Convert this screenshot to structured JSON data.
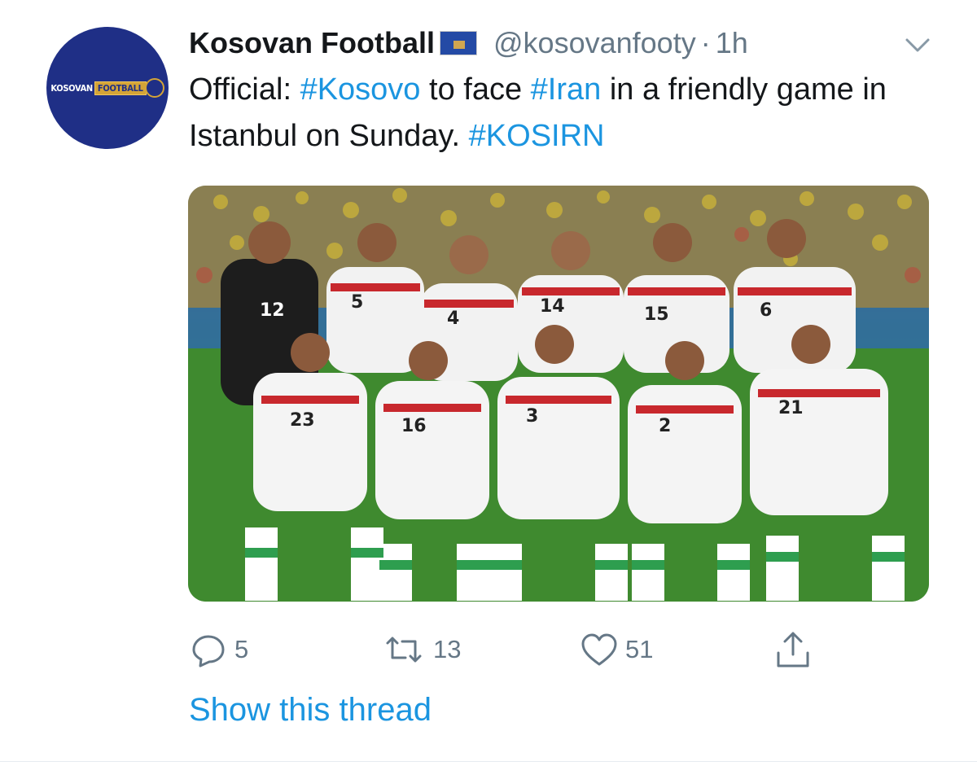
{
  "author": {
    "display_name": "Kosovan Football",
    "handle": "@kosovanfooty",
    "separator": "·",
    "time": "1h",
    "avatar_logo_left": "KOSOVAN",
    "avatar_logo_right": "FOOTBALL"
  },
  "tweet": {
    "text_parts": [
      {
        "text": "Official: ",
        "type": "text"
      },
      {
        "text": "#Kosovo",
        "type": "hashtag"
      },
      {
        "text": " to face ",
        "type": "text"
      },
      {
        "text": "#Iran",
        "type": "hashtag"
      },
      {
        "text": " in a friendly game in Istanbul on Sunday. ",
        "type": "text"
      },
      {
        "text": "#KOSIRN",
        "type": "hashtag"
      }
    ]
  },
  "media": {
    "jersey_numbers": [
      "12",
      "5",
      "4",
      "14",
      "15",
      "6",
      "23",
      "16",
      "3",
      "2",
      "21"
    ]
  },
  "actions": {
    "reply_count": "5",
    "retweet_count": "13",
    "like_count": "51"
  },
  "thread_link": "Show this thread",
  "colors": {
    "link": "#1b95e0",
    "muted": "#657786",
    "avatar_bg": "#1f2f86"
  }
}
